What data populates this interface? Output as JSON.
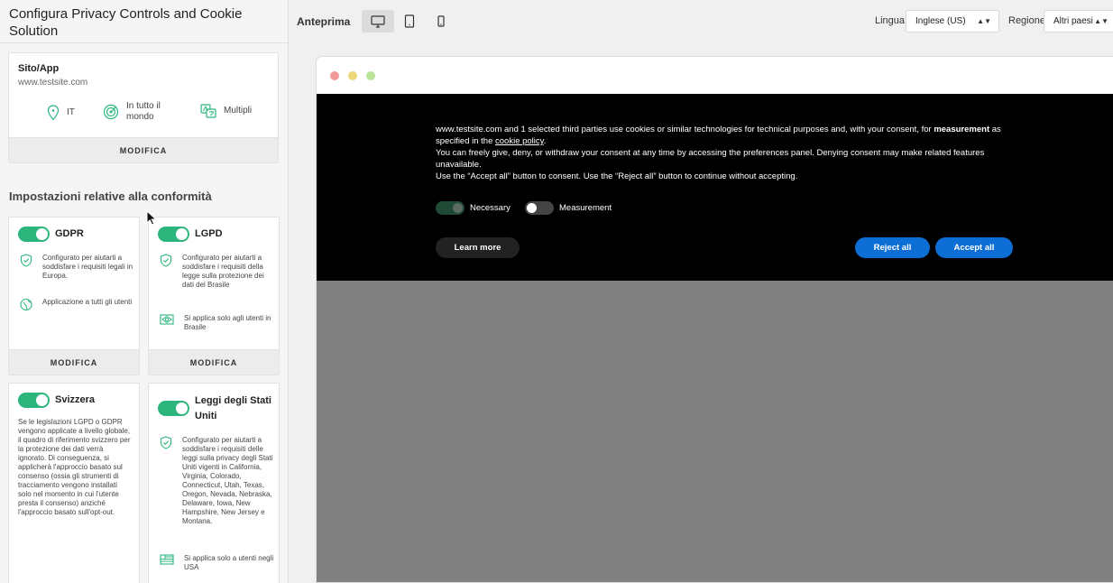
{
  "left_panel": {
    "title": "Configura Privacy Controls and Cookie Solution",
    "site_card": {
      "heading": "Sito/App",
      "url": "www.testsite.com",
      "props": [
        {
          "icon": "location-pin-icon",
          "label": "IT"
        },
        {
          "icon": "radar-icon",
          "label": "In tutto il mondo"
        },
        {
          "icon": "translate-icon",
          "label": "Multipli"
        }
      ],
      "edit_label": "MODIFICA"
    },
    "section_title": "Impostazioni relative alla conformità",
    "gdpr": {
      "name": "GDPR",
      "row1": "Configurato per aiutarti a soddisfare i requisiti legali in Europa.",
      "row2": "Applicazione a tutti gli utenti",
      "edit_label": "MODIFICA"
    },
    "lgpd": {
      "name": "LGPD",
      "row1": "Configurato per aiutarti a soddisfare i requisiti della legge sulla protezione dei dati del Brasile",
      "row2": "Si applica solo agli utenti in Brasile",
      "edit_label": "MODIFICA"
    },
    "svizzera": {
      "name": "Svizzera",
      "text": "Se le legislazioni LGPD o GDPR vengono applicate a livello globale, il quadro di riferimento svizzero per la protezione dei dati verrà ignorato. Di conseguenza, si applicherà l'approccio basato sul consenso (ossia gli strumenti di tracciamento vengono installati solo nel momento in cui l'utente presta il consenso) anziché l'approccio basato sull'opt-out."
    },
    "usa": {
      "name": "Leggi degli Stati Uniti",
      "row1": "Configurato per aiutarti a soddisfare i requisiti delle leggi sulla privacy degli Stati Uniti vigenti in California, Virginia, Colorado, Connecticut, Utah, Texas, Oregon, Nevada, Nebraska, Delaware, Iowa, New Hampshire, New Jersey e Montana.",
      "row2": "Si applica solo a utenti negli USA"
    }
  },
  "topbar": {
    "preview_label": "Anteprima",
    "language_label": "Lingua",
    "language_value": "Inglese (US)",
    "region_label": "Regione",
    "region_value": "Altri paesi"
  },
  "banner": {
    "p1_a": "www.testsite.com and 1 selected third parties use cookies or similar technologies for technical purposes and, with your consent, for ",
    "p1_bold": "measurement",
    "p1_b": " as specified in the ",
    "p1_link": "cookie policy",
    "p1_c": ".",
    "p2": "You can freely give, deny, or withdraw your consent at any time by accessing the preferences panel. Denying consent may make related features unavailable.",
    "p3": "Use the “Accept all” button to consent. Use the “Reject all” button to continue without accepting.",
    "necessary_label": "Necessary",
    "measurement_label": "Measurement",
    "learn_more": "Learn more",
    "reject_all": "Reject all",
    "accept_all": "Accept all"
  },
  "colors": {
    "toggle_green": "#2cb67d",
    "button_blue": "#0d6fd6",
    "banner_bg": "#000000",
    "page_bg": "#808080"
  }
}
